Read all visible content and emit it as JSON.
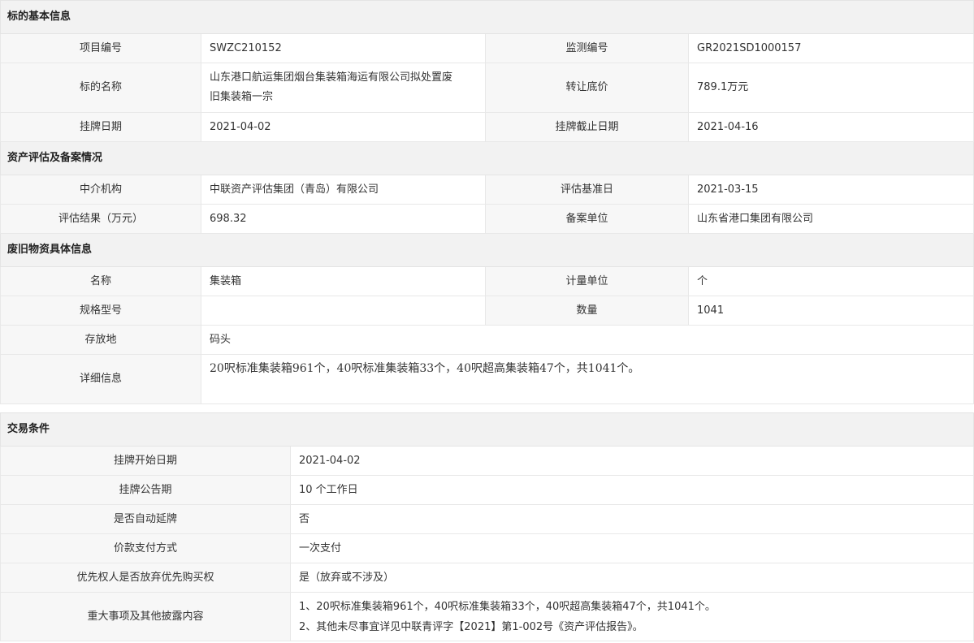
{
  "basic": {
    "section_title": "标的基本信息",
    "project_no_label": "项目编号",
    "project_no": "SWZC210152",
    "monitor_no_label": "监测编号",
    "monitor_no": "GR2021SD1000157",
    "name_label": "标的名称",
    "name_line1": "山东港口航运集团烟台集装箱海运有限公司拟处置废",
    "name_line2": "旧集装箱一宗",
    "price_label": "转让底价",
    "price": "789.1万元",
    "list_date_label": "挂牌日期",
    "list_date": "2021-04-02",
    "end_date_label": "挂牌截止日期",
    "end_date": "2021-04-16"
  },
  "assessment": {
    "section_title": "资产评估及备案情况",
    "agency_label": "中介机构",
    "agency": "中联资产评估集团（青岛）有限公司",
    "base_date_label": "评估基准日",
    "base_date": "2021-03-15",
    "result_label": "评估结果（万元）",
    "result": "698.32",
    "filing_label": "备案单位",
    "filing": "山东省港口集团有限公司"
  },
  "material": {
    "section_title": "废旧物资具体信息",
    "name_label": "名称",
    "name": "集装箱",
    "unit_label": "计量单位",
    "unit": "个",
    "spec_label": "规格型号",
    "spec": "",
    "qty_label": "数量",
    "qty": "1041",
    "storage_label": "存放地",
    "storage": "码头",
    "detail_label": "详细信息",
    "detail": "20呎标准集装箱961个，40呎标准集装箱33个，40呎超高集装箱47个，共1041个。"
  },
  "trade": {
    "section_title": "交易条件",
    "start_label": "挂牌开始日期",
    "start": "2021-04-02",
    "period_label": "挂牌公告期",
    "period": "10 个工作日",
    "auto_label": "是否自动延牌",
    "auto": "否",
    "payment_label": "价款支付方式",
    "payment": "一次支付",
    "priority_label": "优先权人是否放弃优先购买权",
    "priority": "是（放弃或不涉及）",
    "disclosure_label": "重大事项及其他披露内容",
    "disclosure_line1": "1、20呎标准集装箱961个，40呎标准集装箱33个，40呎超高集装箱47个，共1041个。",
    "disclosure_line2": "2、其他未尽事宜详见中联青评字【2021】第1-002号《资产评估报告》。"
  }
}
